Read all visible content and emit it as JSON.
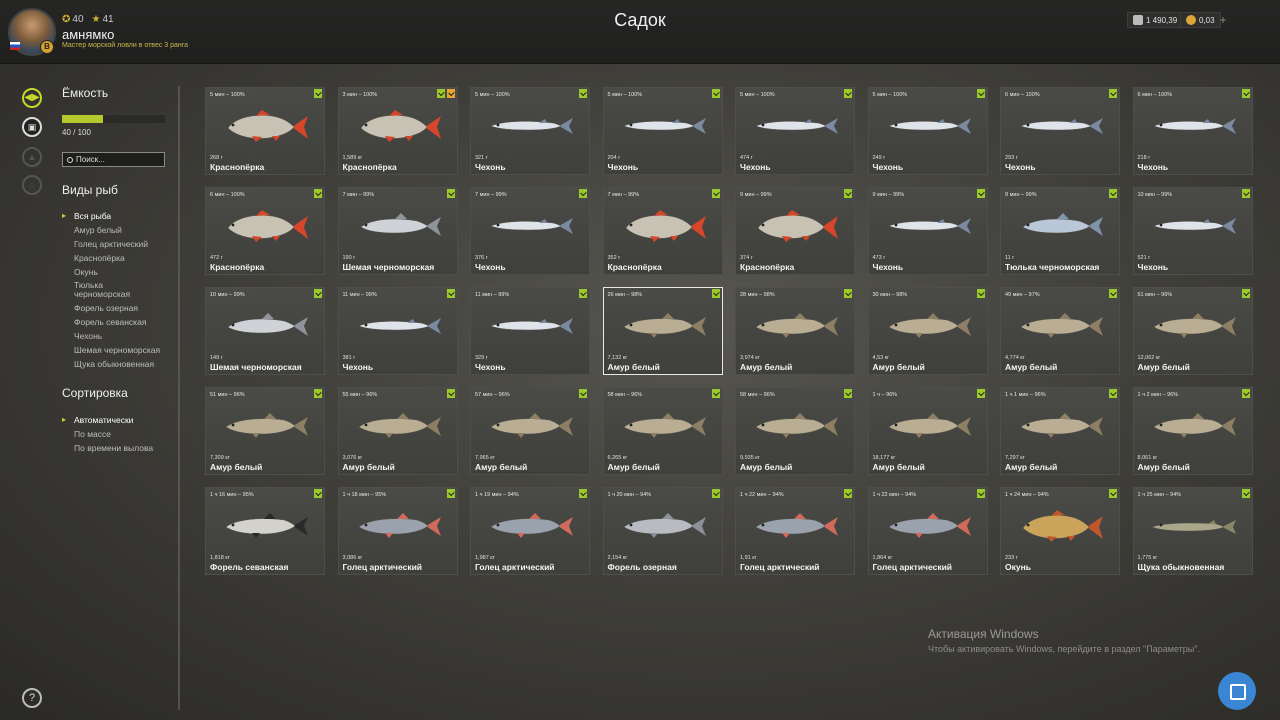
{
  "header": {
    "title": "Садок",
    "player": {
      "stat1": "40",
      "stat2": "41",
      "name": "амнямко",
      "rank": "Мастер морской ловли в отвес 3 ранга",
      "badge": "B"
    },
    "currency": {
      "silver": "1 490,39",
      "gold": "0,03"
    },
    "plus": "+"
  },
  "left_panel": {
    "capacity_title": "Ёмкость",
    "capacity_text": "40 / 100",
    "capacity_fraction": 0.4,
    "search_placeholder": "Поиск...",
    "species_title": "Виды рыб",
    "species": [
      "Вся рыба",
      "Амур белый",
      "Голец арктический",
      "Краснопёрка",
      "Окунь",
      "Тюлька черноморская",
      "Форель озерная",
      "Форель севанская",
      "Чехонь",
      "Шемая черноморская",
      "Щука обыкновенная"
    ],
    "sort_title": "Сортировка",
    "sort_options": [
      "Автоматически",
      "По массе",
      "По времени вылова"
    ]
  },
  "accent_color": "#b4c82c",
  "help": "?",
  "cards": [
    {
      "meta": "5 мин – 100%",
      "weight": "268 г",
      "name": "Краснопёрка",
      "type": "rudd",
      "tags": 1
    },
    {
      "meta": "3 мин – 100%",
      "weight": "1,589 кг",
      "name": "Краснопёрка",
      "type": "rudd",
      "tags": 2
    },
    {
      "meta": "5 мин – 100%",
      "weight": "321 г",
      "name": "Чехонь",
      "type": "sabre",
      "tags": 1
    },
    {
      "meta": "5 мин – 100%",
      "weight": "204 г",
      "name": "Чехонь",
      "type": "sabre",
      "tags": 1
    },
    {
      "meta": "5 мин – 100%",
      "weight": "474 г",
      "name": "Чехонь",
      "type": "sabre",
      "tags": 1
    },
    {
      "meta": "5 мин – 100%",
      "weight": "249 г",
      "name": "Чехонь",
      "type": "sabre",
      "tags": 1
    },
    {
      "meta": "6 мин – 100%",
      "weight": "293 г",
      "name": "Чехонь",
      "type": "sabre",
      "tags": 1
    },
    {
      "meta": "6 мин – 100%",
      "weight": "218 г",
      "name": "Чехонь",
      "type": "sabre",
      "tags": 1
    },
    {
      "meta": "6 мин – 100%",
      "weight": "472 г",
      "name": "Краснопёрка",
      "type": "rudd",
      "tags": 1
    },
    {
      "meta": "7 мин – 99%",
      "weight": "190 г",
      "name": "Шемая черноморская",
      "type": "shemaya",
      "tags": 1
    },
    {
      "meta": "7 мин – 99%",
      "weight": "376 г",
      "name": "Чехонь",
      "type": "sabre",
      "tags": 1
    },
    {
      "meta": "7 мин – 99%",
      "weight": "352 г",
      "name": "Краснопёрка",
      "type": "rudd",
      "tags": 1
    },
    {
      "meta": "9 мин – 99%",
      "weight": "374 г",
      "name": "Краснопёрка",
      "type": "rudd",
      "tags": 1
    },
    {
      "meta": "9 мин – 99%",
      "weight": "473 г",
      "name": "Чехонь",
      "type": "sabre",
      "tags": 1
    },
    {
      "meta": "9 мин – 99%",
      "weight": "11 г",
      "name": "Тюлька черноморская",
      "type": "sprat",
      "tags": 1
    },
    {
      "meta": "10 мин – 99%",
      "weight": "521 г",
      "name": "Чехонь",
      "type": "sabre",
      "tags": 1
    },
    {
      "meta": "10 мин – 99%",
      "weight": "149 г",
      "name": "Шемая черноморская",
      "type": "shemaya",
      "tags": 1
    },
    {
      "meta": "11 мин – 99%",
      "weight": "381 г",
      "name": "Чехонь",
      "type": "sabre",
      "tags": 1
    },
    {
      "meta": "11 мин – 99%",
      "weight": "329 г",
      "name": "Чехонь",
      "type": "sabre",
      "tags": 1
    },
    {
      "meta": "26 мин – 98%",
      "weight": "7,132 кг",
      "name": "Амур белый",
      "type": "carp",
      "tags": 1,
      "selected": true
    },
    {
      "meta": "28 мин – 98%",
      "weight": "3,974 кг",
      "name": "Амур белый",
      "type": "carp",
      "tags": 1
    },
    {
      "meta": "30 мин – 98%",
      "weight": "4,53 кг",
      "name": "Амур белый",
      "type": "carp",
      "tags": 1
    },
    {
      "meta": "49 мин – 97%",
      "weight": "4,774 кг",
      "name": "Амур белый",
      "type": "carp",
      "tags": 1
    },
    {
      "meta": "51 мин – 96%",
      "weight": "12,062 кг",
      "name": "Амур белый",
      "type": "carp",
      "tags": 1
    },
    {
      "meta": "51 мин – 96%",
      "weight": "7,309 кг",
      "name": "Амур белый",
      "type": "carp",
      "tags": 1
    },
    {
      "meta": "55 мин – 96%",
      "weight": "3,076 кг",
      "name": "Амур белый",
      "type": "carp",
      "tags": 1
    },
    {
      "meta": "57 мин – 96%",
      "weight": "7,965 кг",
      "name": "Амур белый",
      "type": "carp",
      "tags": 1
    },
    {
      "meta": "58 мин – 96%",
      "weight": "6,265 кг",
      "name": "Амур белый",
      "type": "carp",
      "tags": 1
    },
    {
      "meta": "58 мин – 96%",
      "weight": "9,935 кг",
      "name": "Амур белый",
      "type": "carp",
      "tags": 1
    },
    {
      "meta": "1 ч – 96%",
      "weight": "18,177 кг",
      "name": "Амур белый",
      "type": "carp",
      "tags": 1
    },
    {
      "meta": "1 ч 1 мин – 96%",
      "weight": "7,297 кг",
      "name": "Амур белый",
      "type": "carp",
      "tags": 1
    },
    {
      "meta": "1 ч 2 мин – 96%",
      "weight": "8,061 кг",
      "name": "Амур белый",
      "type": "carp",
      "tags": 1
    },
    {
      "meta": "1 ч 16 мин – 95%",
      "weight": "1,818 кг",
      "name": "Форель севанская",
      "type": "trout",
      "tags": 1
    },
    {
      "meta": "1 ч 18 мин – 95%",
      "weight": "3,086 кг",
      "name": "Голец арктический",
      "type": "char",
      "tags": 1
    },
    {
      "meta": "1 ч 19 мин – 94%",
      "weight": "1,987 кг",
      "name": "Голец арктический",
      "type": "char",
      "tags": 1
    },
    {
      "meta": "1 ч 20 мин – 94%",
      "weight": "2,154 кг",
      "name": "Форель озерная",
      "type": "laketrout",
      "tags": 1
    },
    {
      "meta": "1 ч 22 мин – 94%",
      "weight": "1,91 кг",
      "name": "Голец арктический",
      "type": "char",
      "tags": 1
    },
    {
      "meta": "1 ч 22 мин – 94%",
      "weight": "1,864 кг",
      "name": "Голец арктический",
      "type": "char",
      "tags": 1
    },
    {
      "meta": "1 ч 24 мин – 94%",
      "weight": "233 г",
      "name": "Окунь",
      "type": "perch",
      "tags": 1
    },
    {
      "meta": "1 ч 25 мин – 94%",
      "weight": "1,775 кг",
      "name": "Щука обыкновенная",
      "type": "pike",
      "tags": 1
    }
  ],
  "fish_colors": {
    "rudd": {
      "body": "#c7c2b3",
      "fin": "#d5462a",
      "shape": "deep"
    },
    "sabre": {
      "body": "#dfe3ea",
      "fin": "#7b8aa0",
      "shape": "slim"
    },
    "shemaya": {
      "body": "#cfd3d8",
      "fin": "#8f949b",
      "shape": "mid"
    },
    "sprat": {
      "body": "#b9c7d6",
      "fin": "#7f93a8",
      "shape": "mid"
    },
    "carp": {
      "body": "#b9ad93",
      "fin": "#8d7e64",
      "shape": "long"
    },
    "trout": {
      "body": "#d4d2cc",
      "fin": "#2a2a2a",
      "shape": "long"
    },
    "char": {
      "body": "#9aa2ad",
      "fin": "#d06a5a",
      "shape": "long"
    },
    "laketrout": {
      "body": "#b8bcc2",
      "fin": "#8c9098",
      "shape": "long"
    },
    "perch": {
      "body": "#c9a45a",
      "fin": "#c0562c",
      "shape": "deep"
    },
    "pike": {
      "body": "#a9a68a",
      "fin": "#8a8468",
      "shape": "pike"
    }
  },
  "watermark": {
    "title": "Активация Windows",
    "subtitle": "Чтобы активировать Windows, перейдите в раздел \"Параметры\"."
  }
}
